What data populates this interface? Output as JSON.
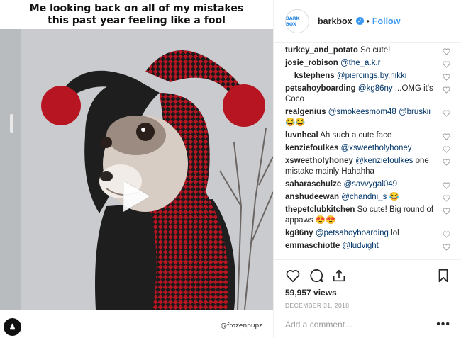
{
  "video": {
    "caption": "Me looking back on all of my mistakes\nthis past year feeling like a fool",
    "watermark": "@frozenpupz",
    "play_icon": "play-icon"
  },
  "header": {
    "avatar_text": "BARK BOX",
    "username": "barkbox",
    "dot": "•",
    "follow_label": "Follow"
  },
  "comments": [
    {
      "user": "turkey_and_potato",
      "text": "So cute!",
      "mentions": []
    },
    {
      "user": "josie_robison",
      "text": "",
      "mentions": [
        "@the_a.k.r"
      ]
    },
    {
      "user": "__kstephens",
      "text": "",
      "mentions": [
        "@piercings.by.nikki"
      ]
    },
    {
      "user": "petsahoyboarding",
      "text": "...OMG it's Coco",
      "mentions": [
        "@kg86ny"
      ]
    },
    {
      "user": "realgenius",
      "text": "😂😂",
      "mentions": [
        "@smokeesmom48",
        "@bruskii"
      ]
    },
    {
      "user": "luvnheal",
      "text": "Ah such a cute face",
      "mentions": []
    },
    {
      "user": "kenziefoulkes",
      "text": "",
      "mentions": [
        "@xsweetholyhoney"
      ]
    },
    {
      "user": "xsweetholyhoney",
      "text": "one mistake mainly Hahahha",
      "mentions": [
        "@kenziefoulkes"
      ]
    },
    {
      "user": "saharaschulze",
      "text": "",
      "mentions": [
        "@savvygal049"
      ]
    },
    {
      "user": "anshudeewan",
      "text": "😂",
      "mentions": [
        "@chandni_s"
      ]
    },
    {
      "user": "thepetclubkitchen",
      "text": "So cute! Big round of appaws 😍😍",
      "mentions": []
    },
    {
      "user": "kg86ny",
      "text": "lol",
      "mentions": [
        "@petsahoyboarding"
      ]
    },
    {
      "user": "emmaschiotte",
      "text": "",
      "mentions": [
        "@ludvight"
      ]
    }
  ],
  "stats": {
    "views": "59,957 views",
    "date": "DECEMBER 31, 2018"
  },
  "add_comment": {
    "placeholder": "Add a comment…",
    "more": "•••"
  },
  "colors": {
    "accent": "#3897f0",
    "mention": "#003569",
    "jester_red": "#b81522"
  }
}
